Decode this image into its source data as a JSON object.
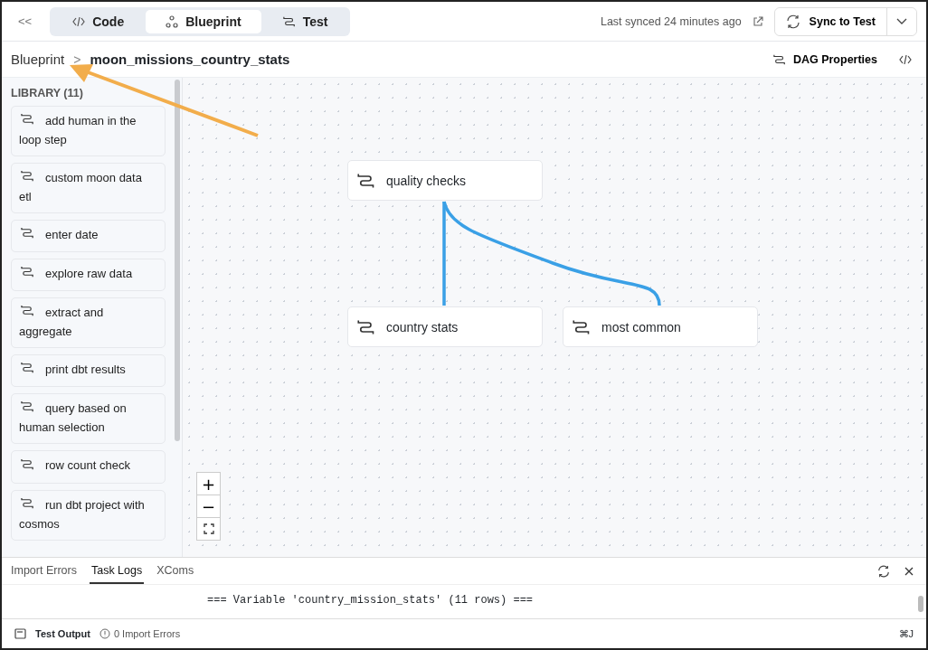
{
  "toolbar": {
    "collapse_icon": "<<",
    "tabs": [
      {
        "label": "Code",
        "selected": false
      },
      {
        "label": "Blueprint",
        "selected": true
      },
      {
        "label": "Test",
        "selected": false
      }
    ],
    "sync_status": "Last synced 24 minutes ago",
    "sync_button": "Sync to Test"
  },
  "breadcrumb": {
    "parent": "Blueprint",
    "separator": ">",
    "current": "moon_missions_country_stats",
    "actions": [
      {
        "label": "DAG Properties"
      }
    ]
  },
  "library": {
    "title": "LIBRARY (11)",
    "items": [
      "add human in the loop step",
      "custom moon data etl",
      "enter date",
      "explore raw data",
      "extract and aggregate",
      "print dbt results",
      "query based on human selection",
      "row count check",
      "run dbt project with cosmos"
    ]
  },
  "canvas": {
    "nodes": [
      {
        "label": "quality checks"
      },
      {
        "label": "country stats"
      },
      {
        "label": "most common"
      }
    ],
    "zoom_controls": [
      "+",
      "−"
    ]
  },
  "bottom_panel": {
    "tabs": [
      {
        "label": "Import Errors",
        "selected": false
      },
      {
        "label": "Task Logs",
        "selected": true
      },
      {
        "label": "XComs",
        "selected": false
      }
    ],
    "log_lines": [
      "=== Variable 'country_mission_stats' (11 rows) ==="
    ]
  },
  "status_bar": {
    "test_output": "Test Output",
    "import_errors": "0 Import Errors",
    "shortcut": "⌘J"
  }
}
